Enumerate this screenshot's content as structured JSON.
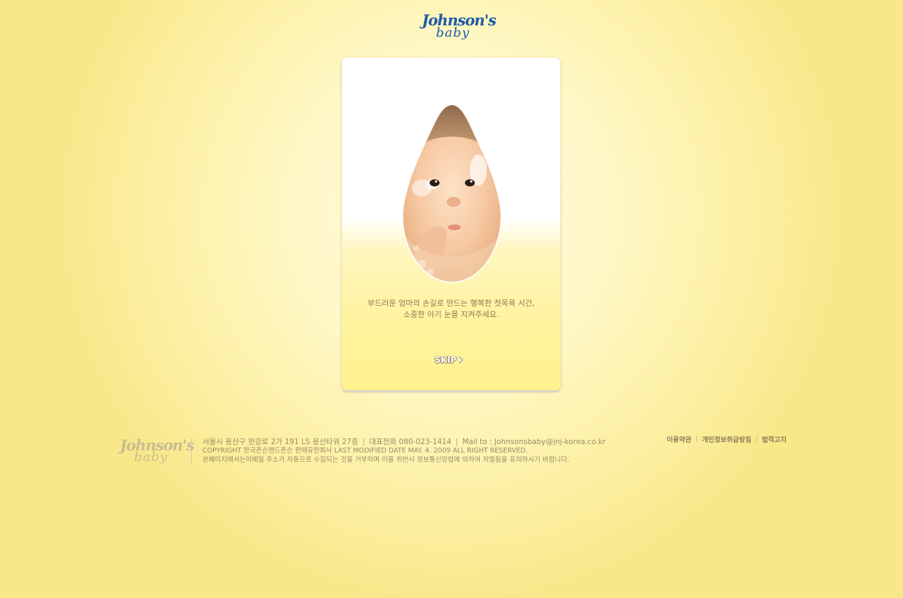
{
  "header": {
    "logo_script": "Johnson's",
    "logo_sub": "baby"
  },
  "card": {
    "image_alt": "baby face in a water drop",
    "message_line1": "부드러운 엄마의 손길로 만드는 행복한 첫목욕 시간,",
    "message_line2": "소중한 아기 눈을 지켜주세요.",
    "skip_label": "SKIP",
    "skip_icon": "chevron-right-icon"
  },
  "footer": {
    "logo_script": "Johnson's",
    "logo_sub": "baby",
    "address": "서울시 용산구 한강로 2가 191 LS 용산타워 27층",
    "phone": "대표전화 080-023-1414",
    "mail": "Mail to : Johnsonsbaby@jnj-korea.co.kr",
    "copyright": "COPYRIGHT 한국존슨앤드존슨 판매유한회사  LAST MODIFIED DATE MAY. 4. 2009 ALL RIGHT RESERVED.",
    "notice": "본페이지에서는이메일 주소가 자동으로 수집되는 것을 거부하며 이를 위반시 정보통신망법에 의하여 처벌됨을 유의하시기 바랍니다.",
    "links": [
      "이용약관",
      "개인정보취급방침",
      "법적고지"
    ]
  },
  "colors": {
    "background": "#fdf1a8",
    "brand_blue": "#1f5aa8",
    "footer_text": "#9a8c66"
  }
}
